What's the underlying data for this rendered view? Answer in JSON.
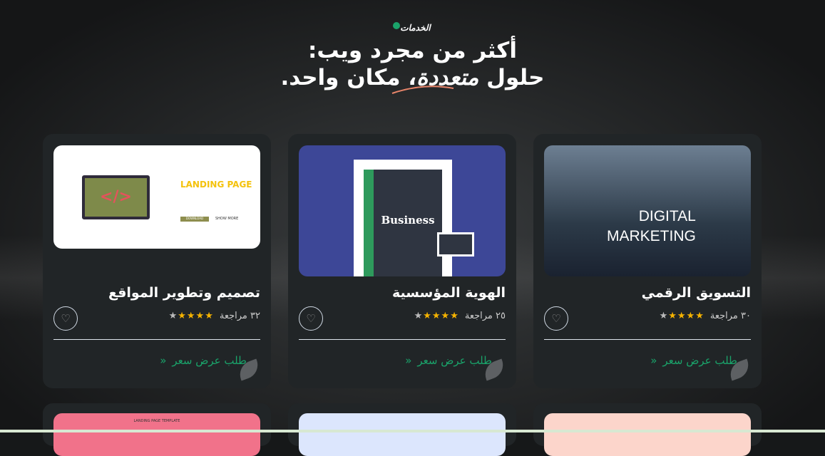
{
  "section": {
    "eyebrow": "الخدمات",
    "title_line1": "أكثر من مجرد ويب:",
    "title_line2_a": "حلول ",
    "title_line2_em": "متعددة",
    "title_line2_b": "، مكان واحد."
  },
  "cards": [
    {
      "title": "التسويق الرقمي",
      "reviews": "٣٠ مراجعة",
      "rating": 4,
      "cta": "طلب عرض سعر",
      "image_text": [
        "DIGITAL",
        "MARKETING"
      ]
    },
    {
      "title": "الهوية المؤسسية",
      "reviews": "٢٥ مراجعة",
      "rating": 4,
      "cta": "طلب عرض سعر",
      "image_text": [
        "Business"
      ]
    },
    {
      "title": "تصميم وتطوير المواقع",
      "reviews": "٣٢ مراجعة",
      "rating": 4,
      "cta": "طلب عرض سعر",
      "image_text": [
        "LANDING PAGE",
        "DOWNLOAD",
        "SHOW MORE"
      ]
    }
  ],
  "bottom_cards": [
    {
      "image_text": "LANDING PAGE TEMPLATE"
    },
    {
      "image_text": ""
    },
    {
      "image_text": ""
    }
  ],
  "colors": {
    "accent": "#1aa36a",
    "star": "#f5b301",
    "card": "#212527"
  }
}
